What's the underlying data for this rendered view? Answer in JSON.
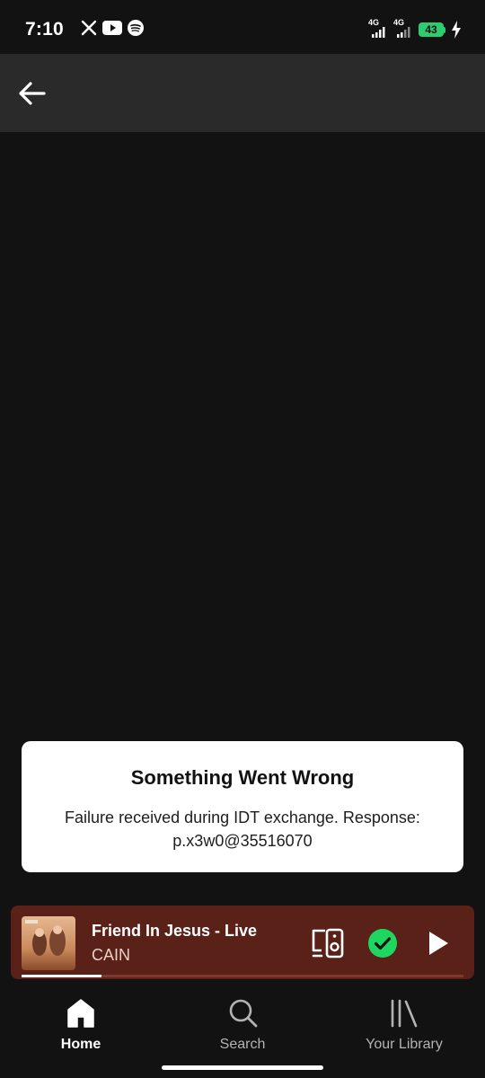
{
  "status_bar": {
    "time": "7:10",
    "app_icons": [
      "x-icon",
      "youtube-icon",
      "spotify-icon"
    ],
    "network_1": "4G",
    "network_2": "4G",
    "battery_level": "43"
  },
  "app_bar": {
    "back_icon": "arrow-left-icon"
  },
  "dialog": {
    "title": "Something Went Wrong",
    "message": "Failure received during IDT exchange. Response: p.x3w0@35516070"
  },
  "now_playing": {
    "title": "Friend In Jesus - Live",
    "artist": "CAIN",
    "progress": 0.18,
    "saved": true,
    "accent": "#1ed760",
    "background": "#5a2118"
  },
  "bottom_nav": {
    "items": [
      {
        "label": "Home",
        "icon": "home-icon",
        "active": true
      },
      {
        "label": "Search",
        "icon": "search-icon",
        "active": false
      },
      {
        "label": "Your Library",
        "icon": "library-icon",
        "active": false
      }
    ]
  }
}
